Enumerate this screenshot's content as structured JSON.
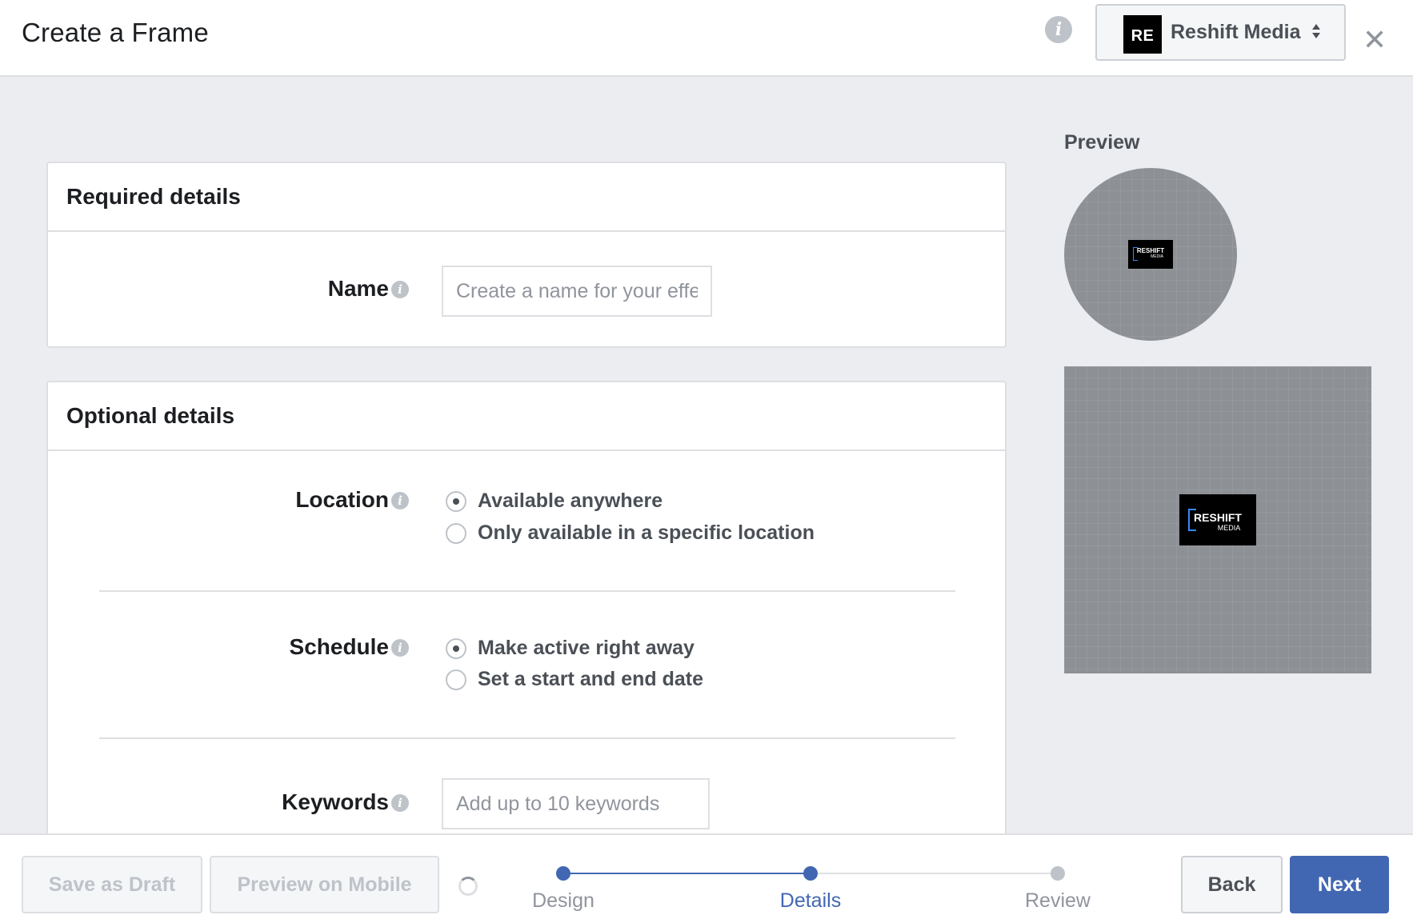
{
  "header": {
    "title": "Create a Frame",
    "account_name": "Reshift Media",
    "account_logo_text": "RE",
    "icons": [
      "info-icon",
      "sort-arrows-icon",
      "close-icon"
    ]
  },
  "required": {
    "title": "Required details",
    "name_label": "Name",
    "name_value": "",
    "name_placeholder": "Create a name for your effect"
  },
  "optional": {
    "title": "Optional details",
    "location": {
      "label": "Location",
      "options": [
        "Available anywhere",
        "Only available in a specific location"
      ],
      "selected": "Available anywhere"
    },
    "schedule": {
      "label": "Schedule",
      "options": [
        "Make active right away",
        "Set a start and end date"
      ],
      "selected": "Make active right away"
    },
    "keywords": {
      "label": "Keywords",
      "value": "",
      "placeholder": "Add up to 10 keywords"
    }
  },
  "preview": {
    "title": "Preview",
    "logo_line1": "RESHIFT",
    "logo_line2": "MEDIA"
  },
  "footer": {
    "save_draft": "Save as Draft",
    "preview_mobile": "Preview on Mobile",
    "steps": [
      {
        "label": "Design",
        "state": "complete"
      },
      {
        "label": "Details",
        "state": "active"
      },
      {
        "label": "Review",
        "state": "upcoming"
      }
    ],
    "back": "Back",
    "next": "Next"
  },
  "colors": {
    "accent": "#4267b2",
    "background": "#ebedf0",
    "border": "#dddfe2",
    "preview_gray": "#8d9095"
  }
}
